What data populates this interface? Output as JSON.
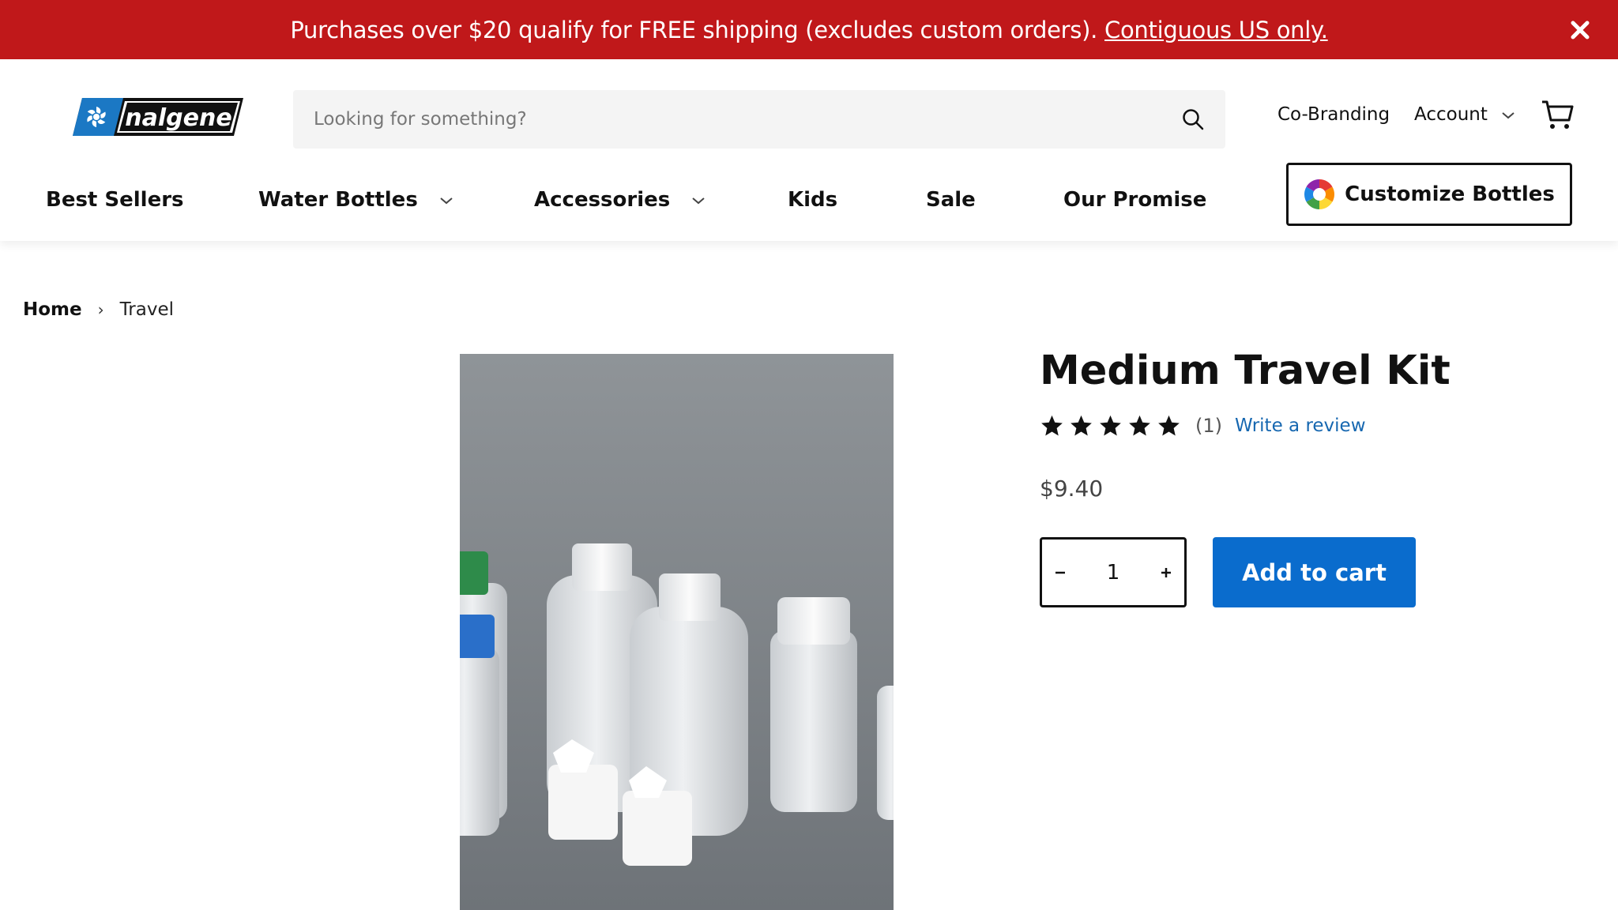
{
  "announcement": {
    "text": "Purchases over $20 qualify for FREE shipping (excludes custom orders).",
    "link": "Contiguous US only.",
    "background": "#c0181a"
  },
  "header": {
    "logo_text": "nalgene",
    "search_placeholder": "Looking for something?",
    "cobranding": "Co-Branding",
    "account": "Account",
    "nav": [
      "Best Sellers",
      "Water Bottles",
      "Accessories",
      "Kids",
      "Sale",
      "Our Promise"
    ],
    "customize": "Customize Bottles"
  },
  "breadcrumb": {
    "home": "Home",
    "separator": "›",
    "current": "Travel"
  },
  "product": {
    "title": "Medium Travel Kit",
    "rating": 5,
    "review_count": "(1)",
    "write_review": "Write a review",
    "price": "$9.40",
    "quantity": "1",
    "add_to_cart": "Add to cart"
  },
  "colors": {
    "accent_blue": "#0a6ccd",
    "link_blue": "#1667b0",
    "announce_red": "#c0181a"
  }
}
